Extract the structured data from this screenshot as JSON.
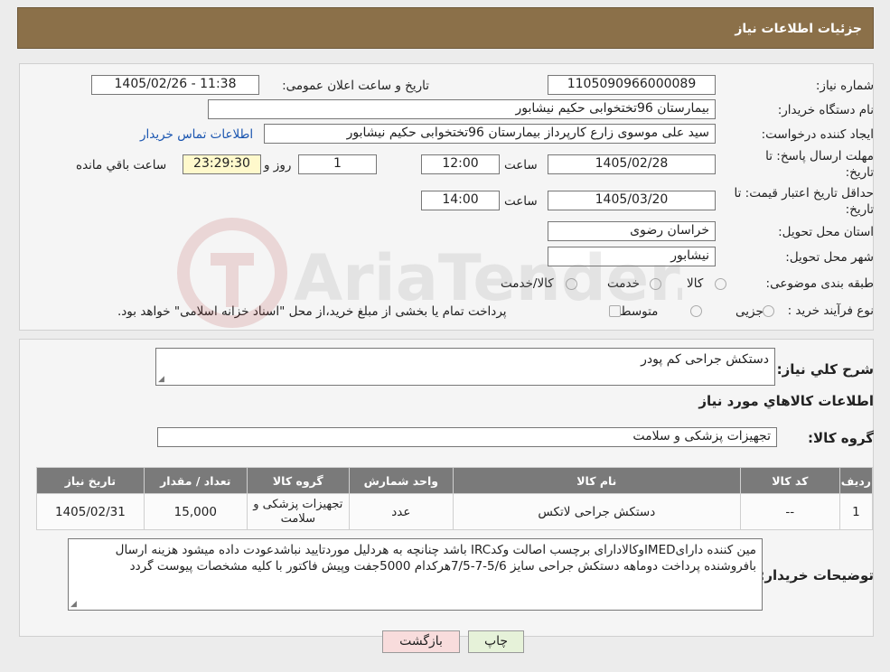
{
  "header": {
    "title": "جزئیات اطلاعات نیاز"
  },
  "fields": {
    "need_number_label": "شماره نیاز:",
    "need_number": "1105090966000089",
    "announce_label": "تاریخ و ساعت اعلان عمومی:",
    "announce_value": "1405/02/26 - 11:38",
    "buyer_org_label": "نام دستگاه خریدار:",
    "buyer_org": "بیمارستان 96تختخوابی حکیم نیشابور",
    "creator_label": "ایجاد کننده درخواست:",
    "creator": "سید علی  موسوی زارع کارپرداز بیمارستان 96تختخوابی حکیم نیشابور",
    "contact_link": "اطلاعات تماس خریدار",
    "deadline_label": "مهلت ارسال پاسخ: تا تاریخ:",
    "deadline_date": "1405/02/28",
    "time_label": "ساعت",
    "deadline_time": "12:00",
    "days": "1",
    "days_label": "روز و",
    "remaining": "23:29:30",
    "remaining_label": "ساعت باقي مانده",
    "validity_label": "حداقل تاریخ اعتبار قیمت: تا تاریخ:",
    "validity_date": "1405/03/20",
    "validity_time": "14:00",
    "province_label": "استان محل تحویل:",
    "province": "خراسان رضوی",
    "city_label": "شهر محل تحویل:",
    "city": "نیشابور",
    "category_label": "طبقه بندی موضوعی:",
    "category_options": [
      "کالا",
      "خدمت",
      "کالا/خدمت"
    ],
    "process_label": "نوع فرآیند خرید :",
    "process_options": [
      "جزیی",
      "متوسط"
    ],
    "process_note": "پرداخت تمام یا بخشی از مبلغ خرید،از محل \"اسناد خزانه اسلامی\" خواهد بود."
  },
  "summary": {
    "desc_label": "شرح کلي نياز:",
    "desc_value": "دستکش جراحی کم پودر",
    "goods_title": "اطلاعات کالاهاي مورد نياز",
    "group_label": "گروه کالا:",
    "group_value": "تجهیزات پزشکی و سلامت"
  },
  "table": {
    "headers": [
      "ردیف",
      "کد کالا",
      "نام کالا",
      "واحد شمارش",
      "گروه کالا",
      "تعداد / مقدار",
      "تاریخ نیاز"
    ],
    "rows": [
      [
        "1",
        "--",
        "دستکش جراحی لاتکس",
        "عدد",
        "تجهیزات پزشکی و سلامت",
        "15,000",
        "1405/02/31"
      ]
    ]
  },
  "notes": {
    "label": "توضیحات خریدار:",
    "value": "مین کننده دارایIMEDوکالادارای برچسب اصالت وکدIRC باشد چنانچه به هردلیل موردتایید نباشدعودت داده میشود هزینه ارسال بافروشنده پرداخت دوماهه دستکش جراحی سایز 5/6-7-7/5هرکدام 5000جفت وپیش فاکتور با کلیه مشخصات پیوست گردد"
  },
  "buttons": {
    "print": "چاپ",
    "back": "بازگشت"
  },
  "watermark": "AriaTender.neT",
  "colors": {
    "header": "#8b7049",
    "table_header": "#7a7a7a",
    "back_button": "#f8dcdc",
    "print_button": "#e6f2d9"
  }
}
